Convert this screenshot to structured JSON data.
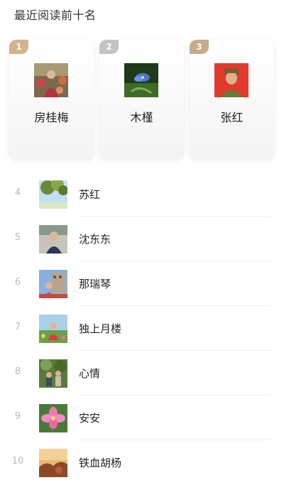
{
  "header": {
    "title": "最近阅读前十名"
  },
  "top3": [
    {
      "rank": "1",
      "name": "房桂梅",
      "badge_color": "#d3b48d",
      "avatar": "woman-flowers-photo"
    },
    {
      "rank": "2",
      "name": "木槿",
      "badge_color": "#c3c3c3",
      "avatar": "blue-flower-photo"
    },
    {
      "rank": "3",
      "name": "张红",
      "badge_color": "#c9a98a",
      "avatar": "man-red-background-photo"
    }
  ],
  "list": [
    {
      "rank": "4",
      "name": "苏红",
      "avatar": "tree-sky-photo"
    },
    {
      "rank": "5",
      "name": "沈东东",
      "avatar": "man-portrait-photo"
    },
    {
      "rank": "6",
      "name": "那瑞琴",
      "avatar": "woman-building-photo"
    },
    {
      "rank": "7",
      "name": "独上月楼",
      "avatar": "woman-flowers-photo"
    },
    {
      "rank": "8",
      "name": "心情",
      "avatar": "people-garden-photo"
    },
    {
      "rank": "9",
      "name": "安安",
      "avatar": "pink-flower-photo"
    },
    {
      "rank": "10",
      "name": "铁血胡杨",
      "avatar": "sunset-landscape-photo"
    }
  ]
}
